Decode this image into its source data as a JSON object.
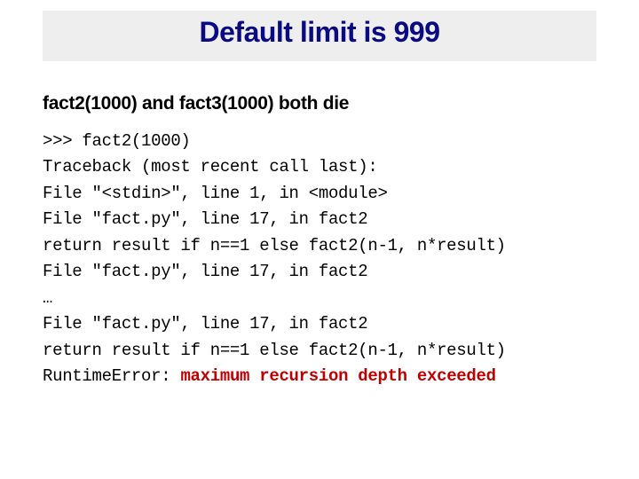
{
  "title": "Default limit is 999",
  "subtitle": "fact2(1000) and fact3(1000) both die",
  "code": {
    "line1": ">>> fact2(1000)",
    "line2": "Traceback (most recent call last):",
    "line3": "File \"<stdin>\", line 1, in <module>",
    "line4": "File \"fact.py\", line 17, in fact2",
    "line5": "return result if n==1 else fact2(n-1, n*result)",
    "line6": "File \"fact.py\", line 17, in fact2",
    "line7": "…",
    "line8": "File \"fact.py\", line 17, in fact2",
    "line9": "return result if n==1 else fact2(n-1, n*result)",
    "line10_prefix": "RuntimeError: ",
    "line10_error": "maximum recursion depth exceeded"
  }
}
